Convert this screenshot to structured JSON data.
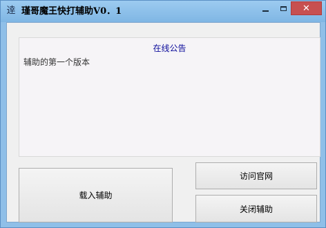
{
  "window": {
    "icon_glyph": "逹",
    "title": "瑾哥魔王快打辅助V0．1",
    "controls": {
      "minimize": "minimize-icon",
      "maximize": "maximize-icon",
      "close": "close-icon",
      "close_glyph": "✕"
    },
    "colors": {
      "titlebar": "#8fbfe8",
      "close": "#c75050",
      "notice_title": "#0a0a9a"
    }
  },
  "notice": {
    "title": "在线公告",
    "body": "辅助的第一个版本"
  },
  "buttons": {
    "load": "载入辅助",
    "visit": "访问官网",
    "close_assist": "关闭辅助"
  }
}
